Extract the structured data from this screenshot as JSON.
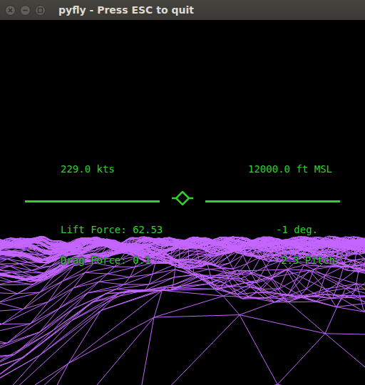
{
  "window": {
    "title": "pyfly - Press ESC to quit"
  },
  "hud": {
    "airspeed": "229.0 kts",
    "altitude": "12000.0 ft MSL",
    "lift": "Lift Force: 62.53",
    "pitch": "-1 deg.",
    "drag": "Drag Force: 0.1",
    "extra": "2.3 Pitch"
  }
}
